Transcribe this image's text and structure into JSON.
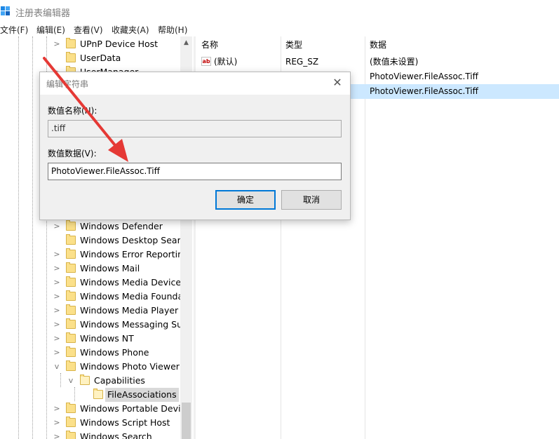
{
  "window": {
    "title": "注册表编辑器",
    "icon": "registry-editor-icon"
  },
  "menu": [
    "文件(F)",
    "编辑(E)",
    "查看(V)",
    "收藏夹(A)",
    "帮助(H)"
  ],
  "tree": {
    "items": [
      {
        "label": "UPnP Device Host",
        "expander": ">",
        "icon": "folder-icon"
      },
      {
        "label": "UserData",
        "expander": "",
        "icon": "folder-icon"
      },
      {
        "label": "UserManager",
        "expander": ">",
        "icon": "folder-icon"
      },
      {
        "label": "Windows Defender",
        "expander": ">",
        "icon": "folder-icon"
      },
      {
        "label": "Windows Desktop Searc",
        "expander": "",
        "icon": "folder-icon"
      },
      {
        "label": "Windows Error Reportin",
        "expander": ">",
        "icon": "folder-icon"
      },
      {
        "label": "Windows Mail",
        "expander": ">",
        "icon": "folder-icon"
      },
      {
        "label": "Windows Media Device I",
        "expander": ">",
        "icon": "folder-icon"
      },
      {
        "label": "Windows Media Founda",
        "expander": ">",
        "icon": "folder-icon"
      },
      {
        "label": "Windows Media Player N",
        "expander": ">",
        "icon": "folder-icon"
      },
      {
        "label": "Windows Messaging Sul",
        "expander": ">",
        "icon": "folder-icon"
      },
      {
        "label": "Windows NT",
        "expander": ">",
        "icon": "folder-icon"
      },
      {
        "label": "Windows Phone",
        "expander": ">",
        "icon": "folder-icon"
      },
      {
        "label": "Windows Photo Viewer",
        "expander": "v",
        "icon": "folder-icon"
      },
      {
        "label": "Capabilities",
        "expander": "v",
        "icon": "folder-open-icon"
      },
      {
        "label": "FileAssociations",
        "expander": "",
        "icon": "folder-open-icon",
        "selected": true
      },
      {
        "label": "Windows Portable Devic",
        "expander": ">",
        "icon": "folder-icon"
      },
      {
        "label": "Windows Script Host",
        "expander": ">",
        "icon": "folder-icon"
      },
      {
        "label": "Windows Search",
        "expander": ">",
        "icon": "folder-icon"
      }
    ]
  },
  "list": {
    "headers": {
      "name": "名称",
      "type": "类型",
      "data": "数据"
    },
    "rows": [
      {
        "name": "(默认)",
        "type": "REG_SZ",
        "data": "(数值未设置)",
        "selected": false
      },
      {
        "name": "",
        "type": "",
        "data": "PhotoViewer.FileAssoc.Tiff",
        "selected": false
      },
      {
        "name": "",
        "type": "",
        "data": "PhotoViewer.FileAssoc.Tiff",
        "selected": true
      }
    ]
  },
  "dialog": {
    "title": "编辑字符串",
    "name_label": "数值名称(N):",
    "name_value": ".tiff",
    "data_label": "数值数据(V):",
    "data_value": "PhotoViewer.FileAssoc.Tiff",
    "ok_label": "确定",
    "cancel_label": "取消",
    "close_glyph": "✕"
  },
  "colors": {
    "selection": "#cce8ff",
    "annotation_arrow": "#e53935",
    "folder": "#fbe08a"
  }
}
